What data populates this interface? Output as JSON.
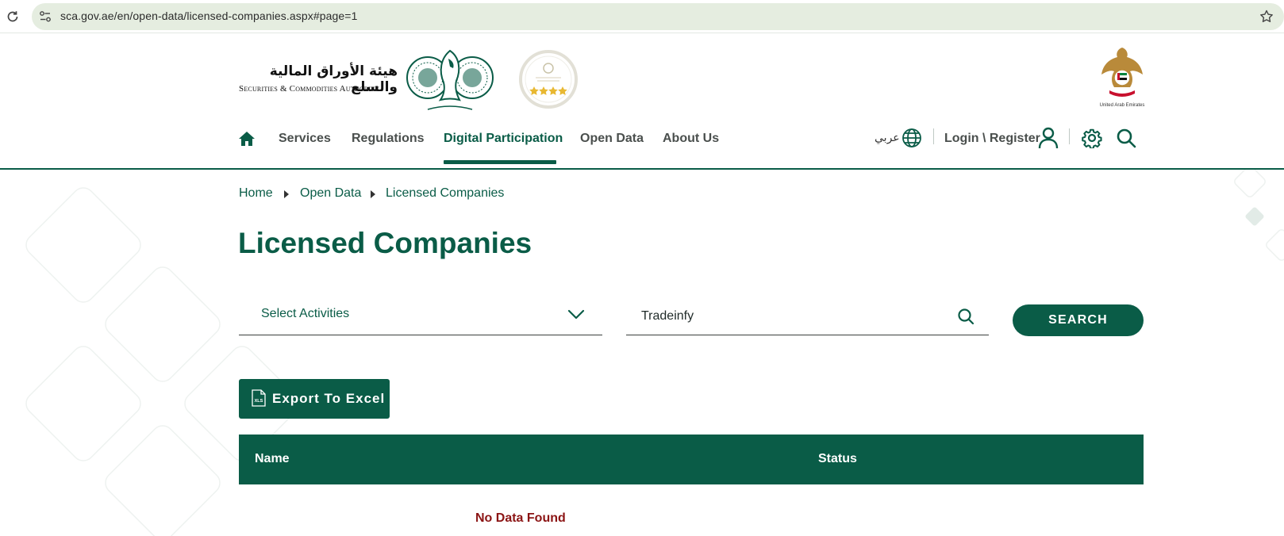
{
  "browser": {
    "url": "sca.gov.ae/en/open-data/licensed-companies.aspx#page=1"
  },
  "header": {
    "logo_arabic": "هيئة الأوراق المالية والسلع",
    "logo_english": "Securities & Commodities Authority",
    "emblem_caption": "United Arab Emirates"
  },
  "nav": {
    "items": [
      {
        "label": "Services"
      },
      {
        "label": "Regulations"
      },
      {
        "label": "Digital Participation",
        "active": true
      },
      {
        "label": "Open Data"
      },
      {
        "label": "About Us"
      }
    ],
    "language_label": "عربي",
    "login_label": "Login \\ Register"
  },
  "breadcrumb": [
    {
      "label": "Home"
    },
    {
      "label": "Open Data"
    },
    {
      "label": "Licensed Companies"
    }
  ],
  "page_title": "Licensed Companies",
  "filters": {
    "activities_placeholder": "Select Activities",
    "search_value": "Tradeinfy",
    "search_button_label": "SEARCH"
  },
  "export": {
    "label": "Export To Excel",
    "icon_text": "XLS"
  },
  "table": {
    "columns": [
      "Name",
      "Status"
    ],
    "empty_message": "No Data Found"
  },
  "colors": {
    "brand_green": "#0a5c47",
    "error_red": "#8b1414",
    "url_bar_bg": "#e5ede0"
  }
}
